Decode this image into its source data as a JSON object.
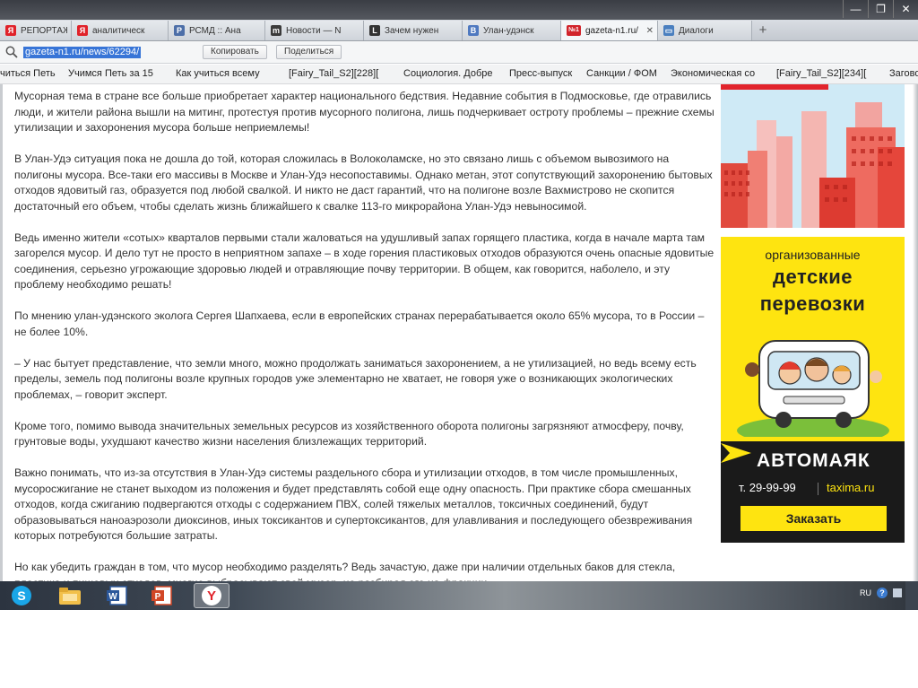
{
  "window": {
    "controls": [
      "—",
      "❐",
      "✕"
    ]
  },
  "tabs": [
    {
      "label": "РЕПОРТАЖИ",
      "favicon": "Я",
      "color": "#e0222a"
    },
    {
      "label": "аналитическ",
      "favicon": "Я",
      "color": "#e0222a"
    },
    {
      "label": "РСМД :: Ана",
      "favicon": "Р",
      "color": "#4d6fa8"
    },
    {
      "label": "Новости — N",
      "favicon": "m",
      "color": "#3b3b3b"
    },
    {
      "label": "Зачем нужен",
      "favicon": "L",
      "color": "#333333"
    },
    {
      "label": "Улан-удэнск",
      "favicon": "B",
      "color": "#4f79c0"
    },
    {
      "label": "gazeta-n1.ru/",
      "favicon": "№1",
      "color": "#d1232a"
    },
    {
      "label": "Диалоги",
      "favicon": "▭",
      "color": "#4a7fbf"
    }
  ],
  "address": {
    "url": "gazeta-n1.ru/news/62294/",
    "copy_label": "Копировать",
    "share_label": "Поделиться"
  },
  "bookmarks": [
    "читься Петь",
    "Учимся Петь за 15",
    "Как учиться всему",
    "[Fairy_Tail_S2][228][",
    "Социология. Добре",
    "Пресс-выпуск",
    "Санкции / ФОМ",
    "Экономическая со",
    "[Fairy_Tail_S2][234][",
    "Заговорщиков"
  ],
  "article": {
    "paragraphs": [
      "Мусорная тема в стране все больше приобретает характер национального бедствия. Недавние события в Подмосковье, где отравились люди, и жители района вышли на митинг, протестуя против мусорного полигона, лишь подчеркивает остроту проблемы – прежние схемы утилизации и захоронения мусора больше неприемлемы!",
      "В Улан-Удэ ситуация пока не дошла до той, которая сложилась в Волоколамске, но это связано лишь с объемом вывозимого на полигоны мусора. Все-таки его массивы в Москве и Улан-Удэ несопоставимы. Однако метан, этот сопутствующий захоронению бытовых отходов ядовитый газ, образуется под любой свалкой. И никто не даст гарантий, что на полигоне возле Вахмистрово не скопится достаточный его объем, чтобы сделать жизнь ближайшего к свалке 113-го микрорайона Улан-Удэ невыносимой.",
      "Ведь именно жители «сотых» кварталов первыми стали жаловаться на удушливый запах горящего пластика, когда в начале марта там загорелся мусор. И дело тут не просто в неприятном запахе – в ходе горения пластиковых отходов образуются очень опасные ядовитые соединения, серьезно угрожающие здоровью людей и отравляющие почву территории. В общем, как говорится, наболело, и эту проблему необходимо решать!",
      "По мнению улан-удэнского эколога Сергея Шапхаева, если в европейских странах перерабатывается около 65% мусора, то в России – не более 10%.",
      "– У нас бытует представление, что земли много, можно продолжать заниматься захоронением, а не утилизацией, но ведь всему есть пределы, земель под полигоны возле крупных городов уже элементарно не хватает, не говоря уже о возникающих экологических проблемах, – говорит эксперт.",
      "Кроме того, помимо вывода значительных земельных ресурсов из хозяйственного оборота полигоны загрязняют атмосферу, почву, грунтовые воды, ухудшают качество жизни населения близлежащих территорий.",
      "Важно понимать, что из-за отсутствия в Улан-Удэ системы раздельного сбора и утилизации отходов, в том числе промышленных, мусоросжигание не станет выходом из положения и будет представлять собой еще одну опасность. При практике сбора смешанных отходов, когда сжиганию подвергаются отходы с содержанием ПВХ, солей тяжелых металлов, токсичных соединений, будут образовываться наноаэрозоли диоксинов, иных токсикантов и супертоксикантов, для улавливания и последующего обезвреживания которых потребуются большие затраты.",
      "Но как убедить граждан в том, что мусор необходимо разделять? Ведь зачастую, даже при наличии отдельных баков для стекла, пластика и пищевых отходов, многие выбрасывают свой мусор, не разбирая его на фракции."
    ]
  },
  "ad": {
    "small_title": "организованные",
    "big_title_1": "детские",
    "big_title_2": "перевозки",
    "brand": "АВТОМАЯК",
    "phone": "т. 29-99-99",
    "site": "taxima.ru",
    "order_label": "Заказать"
  },
  "taskbar": {
    "apps": [
      "skype-icon",
      "explorer-icon",
      "word-icon",
      "powerpoint-icon",
      "yandex-browser-icon"
    ],
    "lang": "RU",
    "help": "?"
  },
  "colors": {
    "ad_yellow": "#fee410",
    "url_highlight": "#3875d7",
    "accent_red": "#e0222a"
  }
}
